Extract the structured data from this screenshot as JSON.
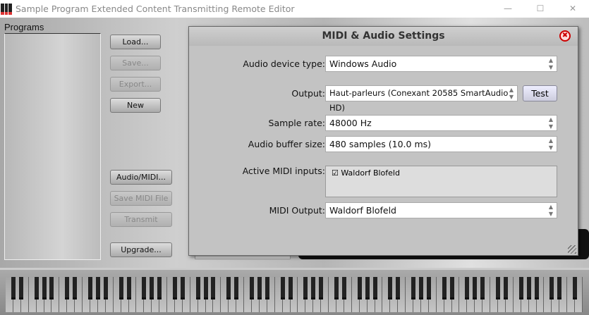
{
  "window": {
    "title": "Sample Program Extended Content Transmitting Remote Editor",
    "minimize": "—",
    "maximize": "☐",
    "close": "✕"
  },
  "left": {
    "programs_label": "Programs",
    "buttons": {
      "load": "Load...",
      "save": "Save...",
      "export": "Export...",
      "new": "New",
      "audio_midi": "Audio/MIDI...",
      "save_midi": "Save MIDI File",
      "transmit": "Transmit",
      "upgrade": "Upgrade..."
    }
  },
  "dialog": {
    "title": "MIDI & Audio Settings",
    "close_icon": "✖",
    "audio_device_type": {
      "label": "Audio device type:",
      "value": "Windows Audio"
    },
    "output": {
      "label": "Output:",
      "value": "Haut-parleurs (Conexant 20585 SmartAudio HD)",
      "test": "Test"
    },
    "sample_rate": {
      "label": "Sample rate:",
      "value": "48000 Hz"
    },
    "buffer_size": {
      "label": "Audio buffer size:",
      "value": "480 samples (10.0 ms)"
    },
    "midi_inputs": {
      "label": "Active MIDI inputs:",
      "items": [
        {
          "name": "Waldorf Blofeld",
          "checked": true
        }
      ]
    },
    "midi_output": {
      "label": "MIDI Output:",
      "value": "Waldorf Blofeld"
    }
  },
  "keyboard": {
    "white_keys": 75
  }
}
